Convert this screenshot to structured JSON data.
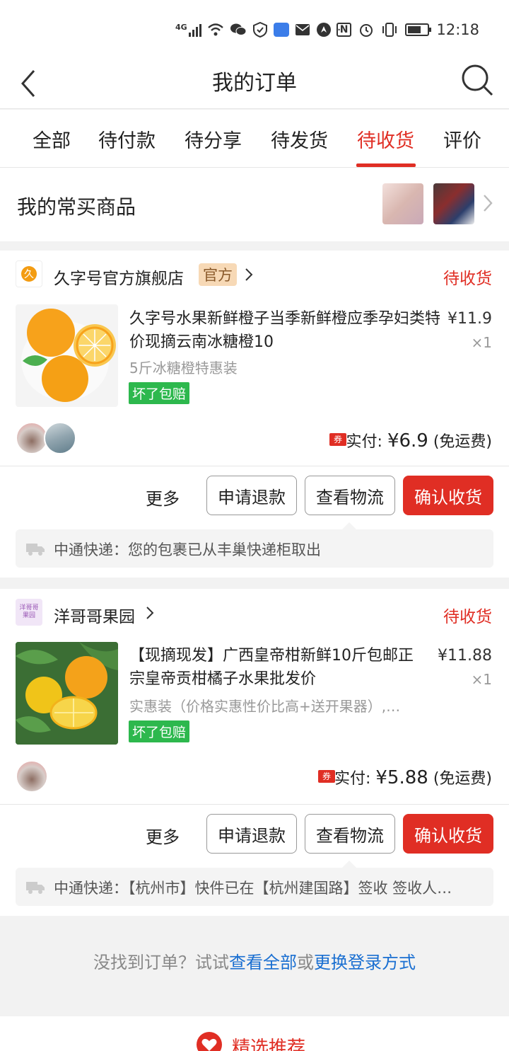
{
  "status_bar": {
    "network": "4G",
    "time": "12:18",
    "icons": [
      "signal-icon",
      "wifi-icon",
      "wechat-icon",
      "shield-icon",
      "app-icon",
      "mail-icon",
      "location-icon",
      "more-icon",
      "nfc-icon",
      "alarm-icon",
      "vibrate-icon",
      "battery-icon"
    ],
    "more_label": "···",
    "nfc_label": "N"
  },
  "header": {
    "title": "我的订单",
    "back_icon": "chevron-left-icon",
    "search_icon": "search-icon"
  },
  "tabs": [
    {
      "label": "全部",
      "active": false
    },
    {
      "label": "待付款",
      "active": false
    },
    {
      "label": "待分享",
      "active": false
    },
    {
      "label": "待发货",
      "active": false
    },
    {
      "label": "待收货",
      "active": true
    },
    {
      "label": "评价",
      "active": false
    }
  ],
  "frequent": {
    "label": "我的常买商品"
  },
  "orders": [
    {
      "shop_name": "久字号官方旗舰店",
      "shop_logo_text": "久字号",
      "official_badge": "官方",
      "status": "待收货",
      "title": "久字号水果新鲜橙子当季新鲜橙应季孕妇类特价现摘云南冰糖橙10",
      "spec": "5斤冰糖橙特惠装",
      "badge": "坏了包赔",
      "price": "¥11.9",
      "qty": "×1",
      "coupon": "券",
      "paid_label": "实付:",
      "paid_amount": "¥6.9",
      "shipping": "(免运费)",
      "more": "更多",
      "btn_refund": "申请退款",
      "btn_logistics": "查看物流",
      "btn_confirm": "确认收货",
      "logistics_text": "中通快递：您的包裹已从丰巢快递柜取出"
    },
    {
      "shop_name": "洋哥哥果园",
      "shop_logo_text": "洋哥哥果园",
      "status": "待收货",
      "title": "【现摘现发】广西皇帝柑新鲜10斤包邮正宗皇帝贡柑橘子水果批发价",
      "spec": "实惠装（价格实惠性价比高+送开果器）,…",
      "badge": "坏了包赔",
      "price": "¥11.88",
      "qty": "×1",
      "coupon": "券",
      "paid_label": "实付:",
      "paid_amount": "¥5.88",
      "shipping": "(免运费)",
      "more": "更多",
      "btn_refund": "申请退款",
      "btn_logistics": "查看物流",
      "btn_confirm": "确认收货",
      "logistics_text": "中通快递：【杭州市】快件已在【杭州建国路】签收 签收人…"
    }
  ],
  "not_found": {
    "prefix": "没找到订单？试试",
    "link1": "查看全部",
    "middle": "或",
    "link2": "更换登录方式"
  },
  "recommend": {
    "label": "精选推荐"
  },
  "colors": {
    "accent": "#e02e24",
    "link": "#1a6fd1",
    "badge_green": "#2db84d"
  }
}
